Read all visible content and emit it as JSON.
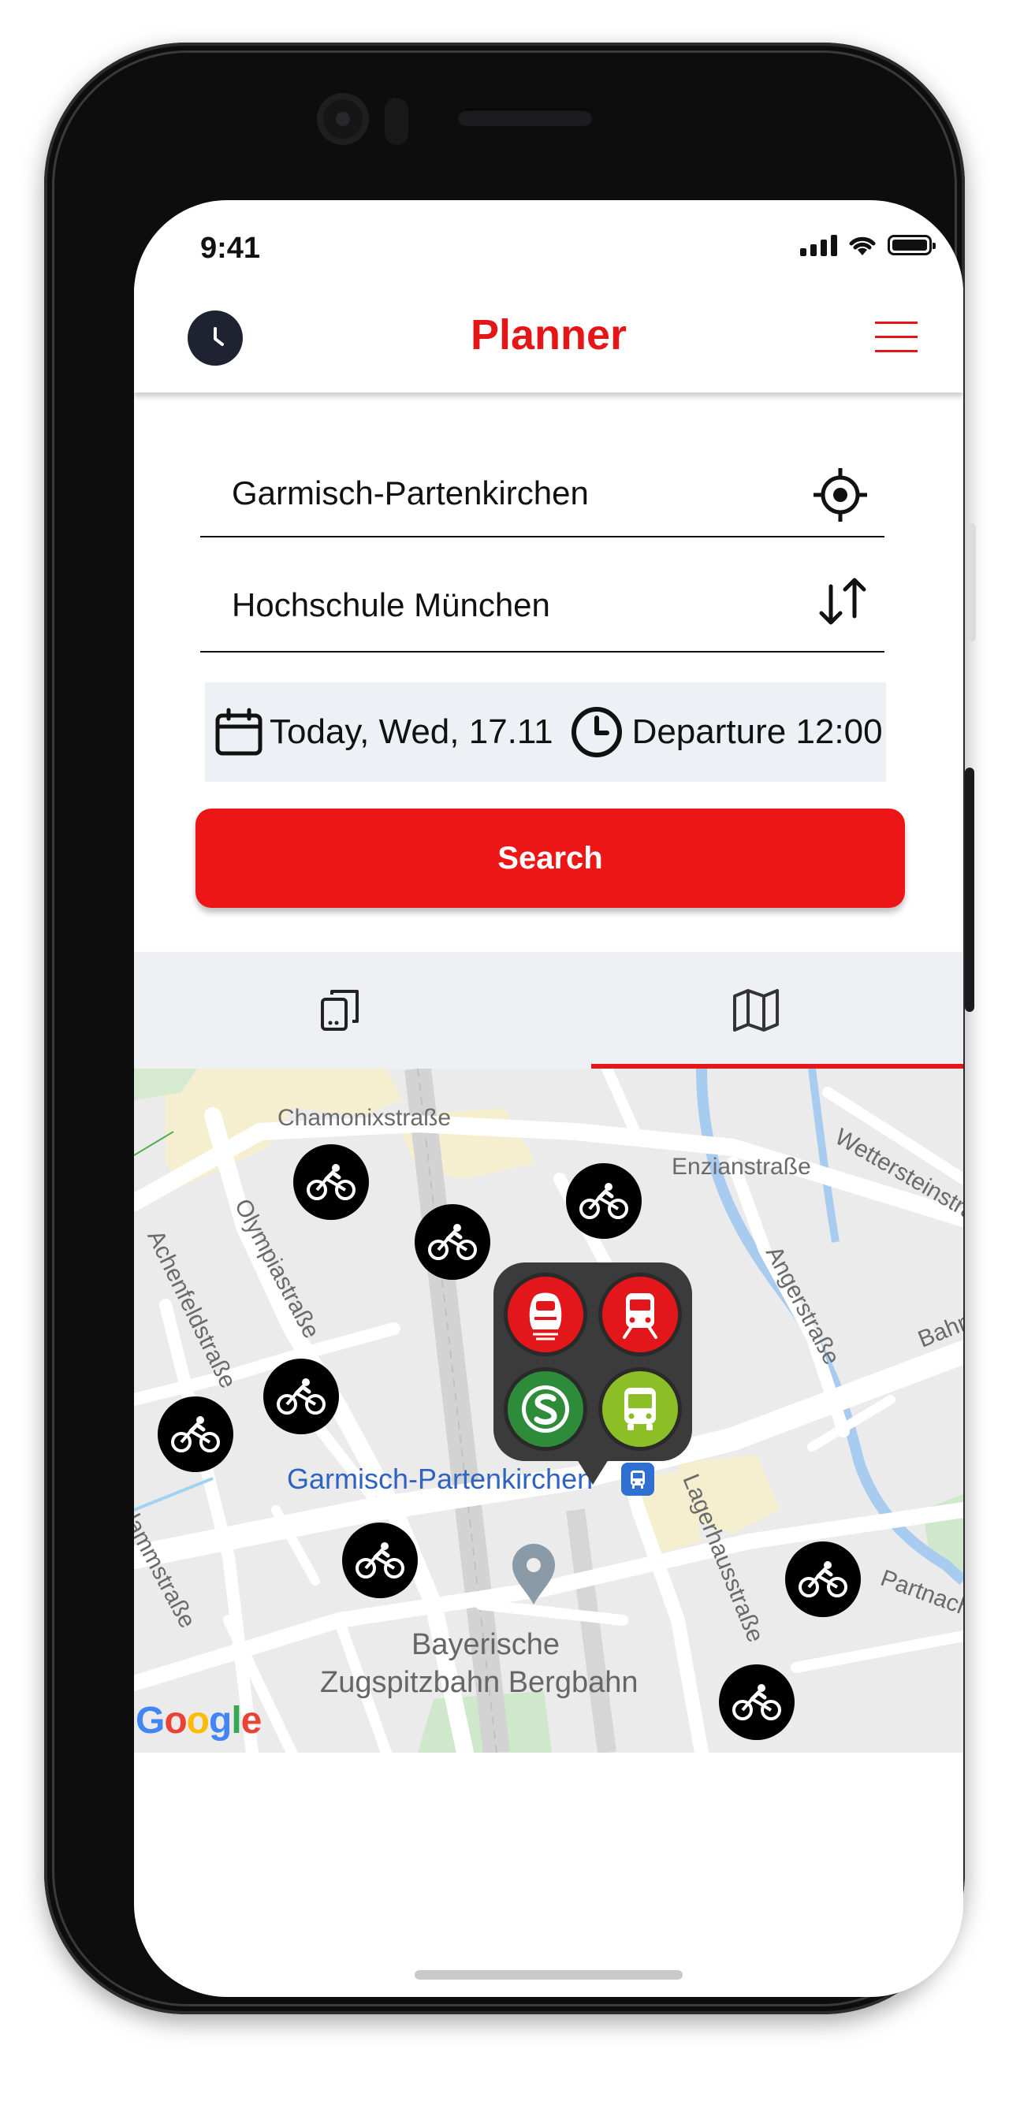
{
  "status_bar": {
    "time": "9:41"
  },
  "header": {
    "title": "Planner"
  },
  "form": {
    "origin": "Garmisch-Partenkirchen",
    "destination": "Hochschule München",
    "date": "Today, Wed, 17.11",
    "time": "Departure 12:00",
    "search_label": "Search"
  },
  "tabs": [
    {
      "icon": "phone-list-icon",
      "active": false
    },
    {
      "icon": "map-icon",
      "active": true
    }
  ],
  "map": {
    "streets": [
      "Chamonixstraße",
      "Enzianstraße",
      "Wettersteinstraße",
      "Olympiastraße",
      "Achenfeldstraße",
      "Angerstraße",
      "Bahnh",
      "Lagerhausstraße",
      "Partnach",
      "lammstraße"
    ],
    "station": "Garmisch-Partenkirchen",
    "poi_line1": "Bayerische",
    "poi_line2": "Zugspitzbahn Bergbahn",
    "attribution": "Google"
  },
  "colors": {
    "accent": "#e41617",
    "ice": "#e3161b",
    "regional": "#e3161b",
    "s_bahn": "#2e8b3a",
    "bus": "#8cbf26"
  }
}
